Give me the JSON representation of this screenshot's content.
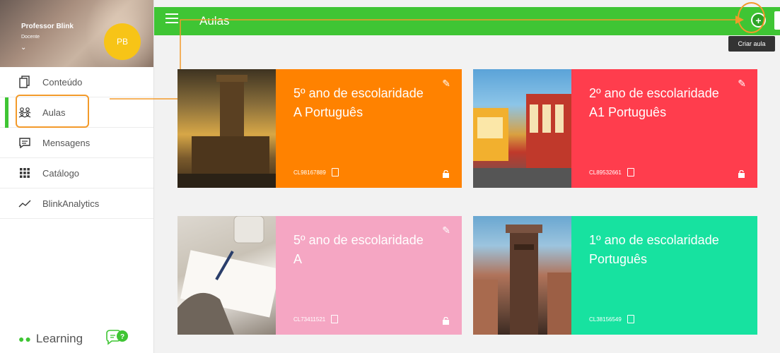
{
  "sidebar": {
    "profile": {
      "name": "Professor Blink",
      "role": "Docente",
      "initials": "PB",
      "chevron": "⌄"
    },
    "items": [
      {
        "label": "Conteúdo",
        "icon": "copy-icon",
        "active": false
      },
      {
        "label": "Aulas",
        "icon": "users-icon",
        "active": true
      },
      {
        "label": "Mensagens",
        "icon": "message-icon",
        "active": false
      },
      {
        "label": "Catálogo",
        "icon": "grid-icon",
        "active": false
      },
      {
        "label": "BlinkAnalytics",
        "icon": "trend-icon",
        "active": false
      }
    ],
    "brand": {
      "dots": "●●",
      "label": "Learning"
    }
  },
  "header": {
    "title": "Aulas",
    "add_symbol": "+",
    "tooltip": "Criar aula"
  },
  "cards": [
    {
      "title_line1": "5º ano de escolaridade",
      "title_line2": "A Português",
      "code": "CL98167889",
      "color": "#ff8200"
    },
    {
      "title_line1": "2º ano de escolaridade",
      "title_line2": "A1 Português",
      "code": "CL89532661",
      "color": "#ff3d4d"
    },
    {
      "title_line1": "5º ano de escolaridade",
      "title_line2": "A",
      "code": "CL73411521",
      "color": "#f5a6c3"
    },
    {
      "title_line1": "1º ano de escolaridade",
      "title_line2": "Português",
      "code": "CL38156549",
      "color": "#17e2a0"
    }
  ],
  "colors": {
    "accent": "#3fc534",
    "annotation": "#f39a2a",
    "tooltip_bg": "#333333"
  }
}
